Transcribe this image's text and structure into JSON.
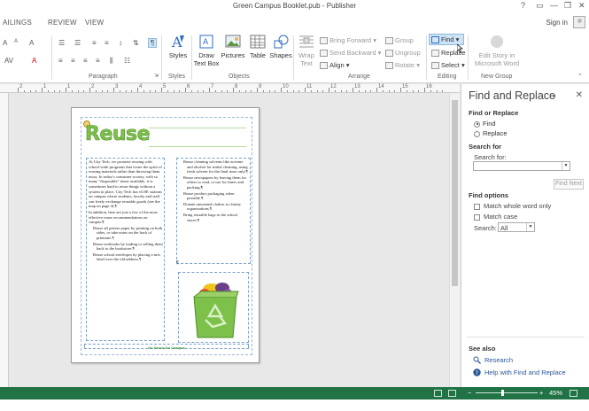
{
  "window": {
    "title": "Green Campus Booklet.pub - Publisher",
    "help": "?",
    "controls": [
      "—",
      "❐",
      "✕"
    ],
    "restore": "▭"
  },
  "tabs": [
    "AILINGS",
    "REVIEW",
    "VIEW"
  ],
  "signin": "Sign in",
  "ribbon": {
    "paragraph_label": "Paragraph",
    "styles_label": "Styles",
    "objects_label": "Objects",
    "arrange_label": "Arrange",
    "editing_label": "Editing",
    "newgroup_label": "New Group",
    "styles_btn": "Styles",
    "draw_textbox": [
      "Draw",
      "Text Box"
    ],
    "pictures": "Pictures",
    "table": "Table",
    "shapes": "Shapes",
    "wrap_text": [
      "Wrap",
      "Text"
    ],
    "bring_forward": "Bring Forward",
    "send_backward": "Send Backward",
    "align": "Align",
    "group": "Group",
    "ungroup": "Ungroup",
    "rotate": "Rotate",
    "find": "Find",
    "replace": "Replace",
    "select": "Select",
    "edit_story": [
      "Edit Story in",
      "Microsoft Word"
    ],
    "pilcrow": "¶",
    "font_ctrls": [
      "A",
      "A",
      "A",
      "A"
    ]
  },
  "ruler": {
    "numbers": [
      "2",
      "1",
      "1",
      "2",
      "3",
      "4",
      "5",
      "6",
      "7",
      "8",
      "9",
      "10",
      "11",
      "12",
      "13",
      "14",
      "15",
      "16"
    ]
  },
  "document": {
    "title": "Reuse",
    "left_para1": "At City Tech, we promote reusing with school-wide programs that foster the spirit of reusing materials rather than throwing them away. In today's consumer society, with so many \"disposable\" items available, it is sometimes hard to reuse things without a system in place. City Tech has vUSE stations on campus where students, faculty and staff can freely exchange reusable goods (see the map on page 4).¶",
    "left_para2": "In addition, here are just a few of the most effective reuse recommendations on campus:¶",
    "left_bullets": [
      "Reuse all printer paper by printing on both sides, or take notes on the back of printouts.¶",
      "Reuse textbooks by trading or selling them back to the bookstore.¶",
      "Reuse school envelopes by placing a new label over the old address.¶"
    ],
    "right_bullets": [
      "Reuse cleaning solvents like acetone and alcohol for initial cleaning, using fresh solvent for the final rinse only.¶",
      "Reuse newspapers by leaving them for others to read, or use for liners and packing.¶",
      "Reuse product packaging when possible.¶",
      "Donate unwanted clothes to charity organizations.¶",
      "Bring reusable bags to the school stores.¶"
    ],
    "footer": "Go Green On Campus",
    "pilcrow": "¶"
  },
  "pane": {
    "title": "Find and Replace",
    "close": "✕",
    "caret": "▾",
    "find_or_replace": "Find or Replace",
    "opt_find": "Find",
    "opt_replace": "Replace",
    "search_for_heading": "Search for",
    "search_for_label": "Search for:",
    "search_value": "",
    "find_next": "Find Next",
    "find_options": "Find options",
    "match_whole": "Match whole word only",
    "match_case": "Match case",
    "search_label": "Search:",
    "search_scope": "All",
    "see_also": "See also",
    "research": "Research",
    "help_link": "Help with Find and Replace"
  },
  "status": {
    "zoom": "45%",
    "minus": "−",
    "plus": "+"
  },
  "colors": {
    "accent": "#217346",
    "title_green": "#7dc04a",
    "link": "#2b5797"
  }
}
